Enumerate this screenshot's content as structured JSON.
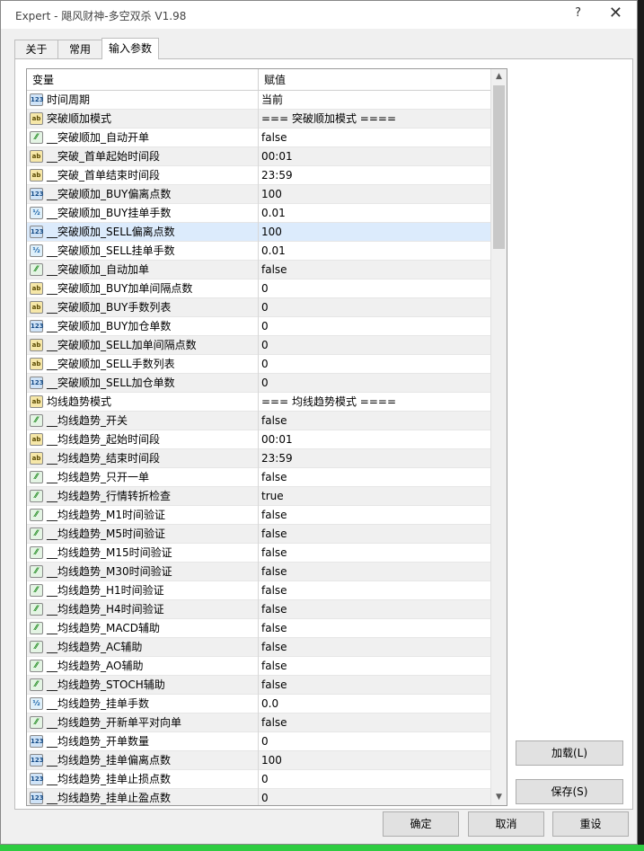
{
  "window": {
    "title": "Expert - 飓风财神-多空双杀 V1.98",
    "help_glyph": "?",
    "close_glyph": "✕"
  },
  "tabs": [
    {
      "label": "关于",
      "active": false
    },
    {
      "label": "常用",
      "active": false
    },
    {
      "label": "输入参数",
      "active": true
    }
  ],
  "grid": {
    "col_variable": "变量",
    "col_value": "赋值",
    "selected_row": 7,
    "rows": [
      {
        "type": "num",
        "icon_text": "123",
        "name": "时间周期",
        "value": "当前"
      },
      {
        "type": "ab",
        "icon_text": "ab",
        "name": "突破顺加模式",
        "value": "=== 突破顺加模式 ===="
      },
      {
        "type": "bool",
        "icon_text": "⁄⁄",
        "name": "__突破顺加_自动开单",
        "value": "false"
      },
      {
        "type": "ab",
        "icon_text": "ab",
        "name": "__突破_首单起始时间段",
        "value": "00:01"
      },
      {
        "type": "ab",
        "icon_text": "ab",
        "name": "__突破_首单结束时间段",
        "value": "23:59"
      },
      {
        "type": "num",
        "icon_text": "123",
        "name": "__突破顺加_BUY偏离点数",
        "value": "100"
      },
      {
        "type": "frac",
        "icon_text": "½",
        "name": "__突破顺加_BUY挂单手数",
        "value": "0.01"
      },
      {
        "type": "num",
        "icon_text": "123",
        "name": "__突破顺加_SELL偏离点数",
        "value": "100"
      },
      {
        "type": "frac",
        "icon_text": "½",
        "name": "__突破顺加_SELL挂单手数",
        "value": "0.01"
      },
      {
        "type": "bool",
        "icon_text": "⁄⁄",
        "name": "__突破顺加_自动加单",
        "value": "false"
      },
      {
        "type": "ab",
        "icon_text": "ab",
        "name": "__突破顺加_BUY加单间隔点数",
        "value": "0"
      },
      {
        "type": "ab",
        "icon_text": "ab",
        "name": "__突破顺加_BUY手数列表",
        "value": "0"
      },
      {
        "type": "num",
        "icon_text": "123",
        "name": "__突破顺加_BUY加仓单数",
        "value": "0"
      },
      {
        "type": "ab",
        "icon_text": "ab",
        "name": "__突破顺加_SELL加单间隔点数",
        "value": "0"
      },
      {
        "type": "ab",
        "icon_text": "ab",
        "name": "__突破顺加_SELL手数列表",
        "value": "0"
      },
      {
        "type": "num",
        "icon_text": "123",
        "name": "__突破顺加_SELL加仓单数",
        "value": "0"
      },
      {
        "type": "ab",
        "icon_text": "ab",
        "name": "均线趋势模式",
        "value": "=== 均线趋势模式 ===="
      },
      {
        "type": "bool",
        "icon_text": "⁄⁄",
        "name": "__均线趋势_开关",
        "value": "false"
      },
      {
        "type": "ab",
        "icon_text": "ab",
        "name": "__均线趋势_起始时间段",
        "value": "00:01"
      },
      {
        "type": "ab",
        "icon_text": "ab",
        "name": "__均线趋势_结束时间段",
        "value": "23:59"
      },
      {
        "type": "bool",
        "icon_text": "⁄⁄",
        "name": "__均线趋势_只开一单",
        "value": "false"
      },
      {
        "type": "bool",
        "icon_text": "⁄⁄",
        "name": "__均线趋势_行情转折检查",
        "value": "true"
      },
      {
        "type": "bool",
        "icon_text": "⁄⁄",
        "name": "__均线趋势_M1时间验证",
        "value": "false"
      },
      {
        "type": "bool",
        "icon_text": "⁄⁄",
        "name": "__均线趋势_M5时间验证",
        "value": "false"
      },
      {
        "type": "bool",
        "icon_text": "⁄⁄",
        "name": "__均线趋势_M15时间验证",
        "value": "false"
      },
      {
        "type": "bool",
        "icon_text": "⁄⁄",
        "name": "__均线趋势_M30时间验证",
        "value": "false"
      },
      {
        "type": "bool",
        "icon_text": "⁄⁄",
        "name": "__均线趋势_H1时间验证",
        "value": "false"
      },
      {
        "type": "bool",
        "icon_text": "⁄⁄",
        "name": "__均线趋势_H4时间验证",
        "value": "false"
      },
      {
        "type": "bool",
        "icon_text": "⁄⁄",
        "name": "__均线趋势_MACD辅助",
        "value": "false"
      },
      {
        "type": "bool",
        "icon_text": "⁄⁄",
        "name": "__均线趋势_AC辅助",
        "value": "false"
      },
      {
        "type": "bool",
        "icon_text": "⁄⁄",
        "name": "__均线趋势_AO辅助",
        "value": "false"
      },
      {
        "type": "bool",
        "icon_text": "⁄⁄",
        "name": "__均线趋势_STOCH辅助",
        "value": "false"
      },
      {
        "type": "frac",
        "icon_text": "½",
        "name": "__均线趋势_挂单手数",
        "value": "0.0"
      },
      {
        "type": "bool",
        "icon_text": "⁄⁄",
        "name": "__均线趋势_开新单平对向单",
        "value": "false"
      },
      {
        "type": "num",
        "icon_text": "123",
        "name": "__均线趋势_开单数量",
        "value": "0"
      },
      {
        "type": "num",
        "icon_text": "123",
        "name": "__均线趋势_挂单偏离点数",
        "value": "100"
      },
      {
        "type": "num",
        "icon_text": "123",
        "name": "__均线趋势_挂单止损点数",
        "value": "0"
      },
      {
        "type": "num",
        "icon_text": "123",
        "name": "__均线趋势_挂单止盈点数",
        "value": "0"
      }
    ]
  },
  "scrollbar": {
    "up_glyph": "▲",
    "down_glyph": "▼"
  },
  "buttons": {
    "load": "加载(L)",
    "save": "保存(S)",
    "ok": "确定",
    "cancel": "取消",
    "reset": "重设"
  },
  "colors": {
    "selected_row": "#dcebfc",
    "alt_row": "#f0f0f0",
    "status_bar": "#2ecc40"
  }
}
